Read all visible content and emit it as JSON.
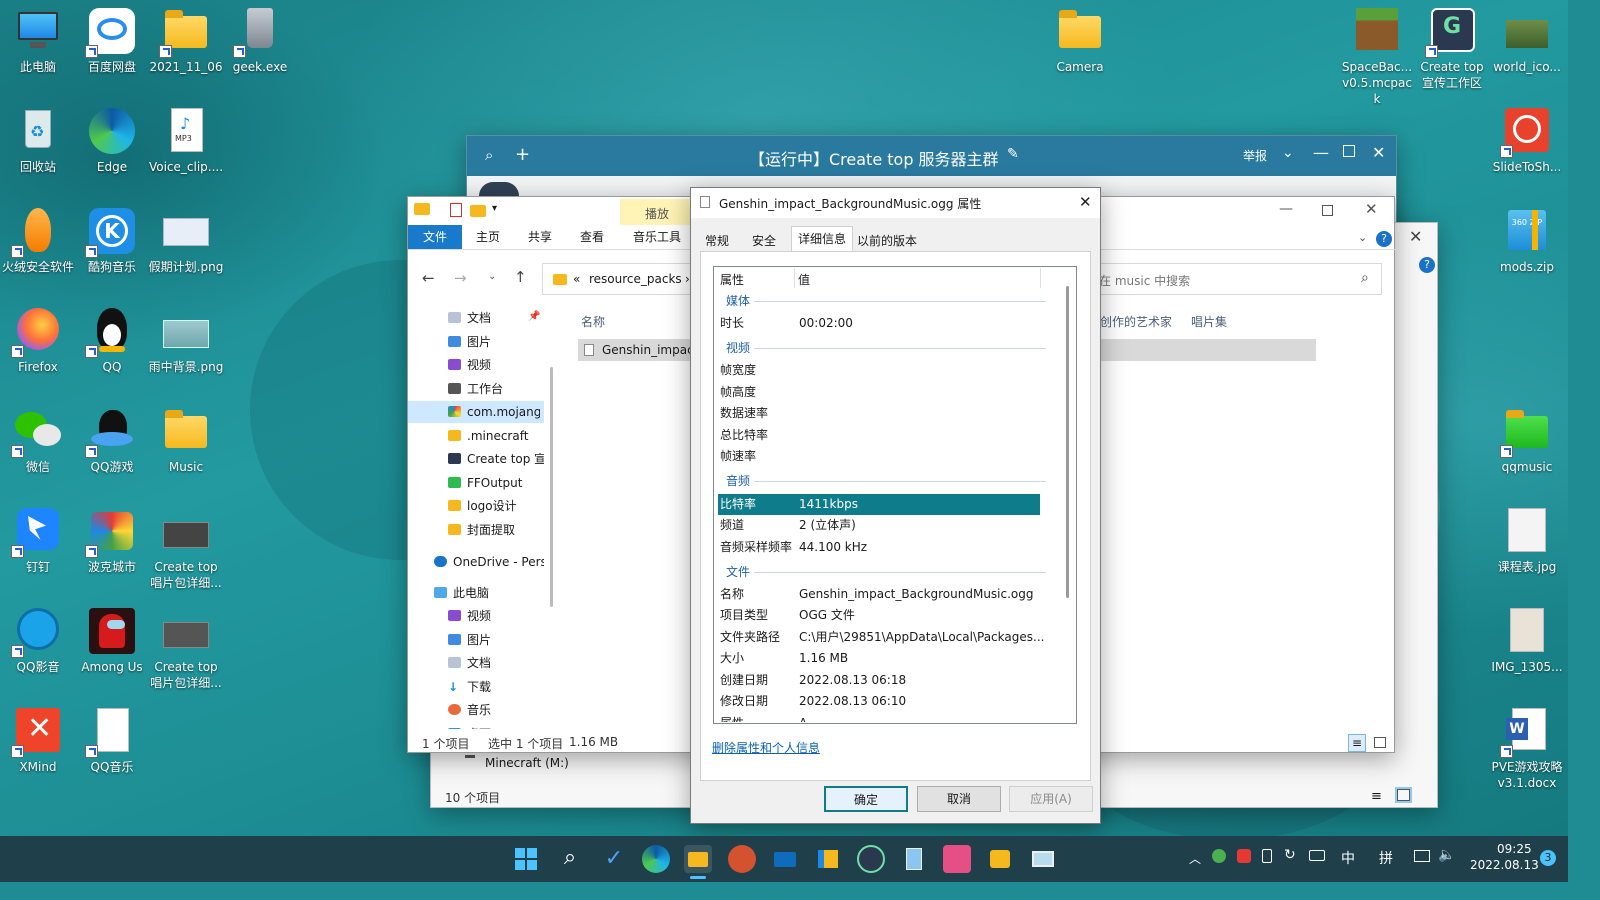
{
  "desktop": {
    "icons": [
      {
        "label": "此电脑"
      },
      {
        "label": "百度网盘"
      },
      {
        "label": "2021_11_06"
      },
      {
        "label": "geek.exe"
      },
      {
        "label": "回收站"
      },
      {
        "label": "Edge"
      },
      {
        "label": "Voice_clip...."
      },
      {
        "label": "火绒安全软件"
      },
      {
        "label": "酷狗音乐"
      },
      {
        "label": "假期计划.png"
      },
      {
        "label": "Firefox"
      },
      {
        "label": "QQ"
      },
      {
        "label": "雨中背景.png"
      },
      {
        "label": "微信"
      },
      {
        "label": "QQ游戏"
      },
      {
        "label": "Music"
      },
      {
        "label": "钉钉"
      },
      {
        "label": "波克城市"
      },
      {
        "label": "Create top 唱片包详细..."
      },
      {
        "label": "QQ影音"
      },
      {
        "label": "Among Us"
      },
      {
        "label": "Create top 唱片包详细..."
      },
      {
        "label": "XMind"
      },
      {
        "label": "QQ音乐"
      },
      {
        "label": "Camera"
      },
      {
        "label": "SpaceBac... v0.5.mcpack"
      },
      {
        "label": "Create top 宣传工作区"
      },
      {
        "label": "world_ico..."
      },
      {
        "label": "SlideToSh..."
      },
      {
        "label": "mods.zip"
      },
      {
        "label": "qqmusic"
      },
      {
        "label": "课程表.jpg"
      },
      {
        "label": "IMG_1305..."
      },
      {
        "label": "PVE游戏攻略 v3.1.docx"
      }
    ],
    "mp3_badge": "MP3",
    "zip_badge": "360 ZIP",
    "word_badge": "W"
  },
  "chat": {
    "title": "【运行中】Create top 服务器主群",
    "report": "举报"
  },
  "explorer": {
    "tab_play_group": "播放",
    "tabs": [
      "文件",
      "主页",
      "共享",
      "查看",
      "音乐工具"
    ],
    "path_prefix": "«",
    "path": "resource_packs",
    "path_sep": "›",
    "search_placeholder": "在 music 中搜索",
    "col_name": "名称",
    "col_artist": "创作的艺术家",
    "col_album": "唱片集",
    "file_row": "Genshin_impact",
    "nav": [
      "文档",
      "图片",
      "视频",
      "工作台",
      "com.mojang",
      ".minecraft",
      "Create top 宣传",
      "FFOutput",
      "logo设计",
      "封面提取",
      "OneDrive - Pers",
      "此电脑",
      "视频",
      "图片",
      "文档",
      "下载",
      "音乐",
      "桌面"
    ],
    "status_count": "1 个项目",
    "status_selected": "选中 1 个项目",
    "status_size": "1.16 MB",
    "back_drive": "Minecraft (M:)",
    "back_count": "10 个项目"
  },
  "props": {
    "title": "Genshin_impact_BackgroundMusic.ogg 属性",
    "tabs": [
      "常规",
      "安全",
      "详细信息",
      "以前的版本"
    ],
    "col_prop": "属性",
    "col_val": "值",
    "sec_media": "媒体",
    "duration_k": "时长",
    "duration_v": "00:02:00",
    "sec_video": "视频",
    "frame_w": "帧宽度",
    "frame_h": "帧高度",
    "data_rate": "数据速率",
    "total_bitrate": "总比特率",
    "frame_rate": "帧速率",
    "sec_audio": "音频",
    "bitrate_k": "比特率",
    "bitrate_v": "1411kbps",
    "channels_k": "频道",
    "channels_v": "2 (立体声)",
    "sample_k": "音频采样频率",
    "sample_v": "44.100 kHz",
    "sec_file": "文件",
    "name_k": "名称",
    "name_v": "Genshin_impact_BackgroundMusic.ogg",
    "type_k": "项目类型",
    "type_v": "OGG 文件",
    "path_k": "文件夹路径",
    "path_v": "C:\\用户\\29851\\AppData\\Local\\Packages...",
    "size_k": "大小",
    "size_v": "1.16 MB",
    "created_k": "创建日期",
    "created_v": "2022.08.13 06:18",
    "modified_k": "修改日期",
    "modified_v": "2022.08.13 06:10",
    "attr_k": "属性",
    "attr_v": "A",
    "remove_link": "删除属性和个人信息",
    "ok": "确定",
    "cancel": "取消",
    "apply": "应用(A)"
  },
  "taskbar": {
    "ime_lang": "中",
    "ime_mode": "拼",
    "time": "09:25",
    "date": "2022.08.13",
    "notif_count": "3"
  },
  "colors": {
    "accent": "#0f7c8c",
    "ribbon_blue": "#1979ca",
    "play_group": "#fff4b5",
    "selected_row": "#0f7c8c"
  }
}
